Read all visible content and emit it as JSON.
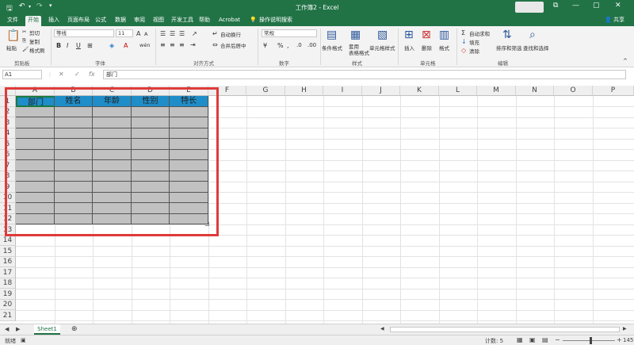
{
  "titlebar": {
    "title": "工作簿2  -  Excel",
    "minimize": "—",
    "restore": "▢",
    "close": "✕",
    "restore_ribbon": "⧉"
  },
  "tabs": [
    "文件",
    "开始",
    "插入",
    "页面布局",
    "公式",
    "数据",
    "审阅",
    "视图",
    "开发工具",
    "帮助",
    "Acrobat"
  ],
  "search_label": "操作说明搜索",
  "share_label": "共享",
  "clipboard": {
    "paste": "粘贴",
    "cut": "剪切",
    "copy": "复制",
    "format_painter": "格式刷",
    "group": "剪贴板"
  },
  "font": {
    "name": "等线",
    "size": "11",
    "bold": "B",
    "italic": "I",
    "underline": "U",
    "group": "字体",
    "size_up": "A",
    "size_down": "A",
    "wen": "wén"
  },
  "alignment": {
    "wrap": "自动换行",
    "merge": "合并后居中",
    "group": "对齐方式"
  },
  "number": {
    "format": "常规",
    "percent": "%",
    "comma": ",",
    "group": "数字"
  },
  "styles": {
    "conditional": "条件格式",
    "table": "套用\n表格格式",
    "cell_styles": "单元格样式",
    "group": "样式"
  },
  "cells": {
    "insert": "插入",
    "delete": "删除",
    "format": "格式",
    "group": "单元格"
  },
  "editing": {
    "autosum": "自动求和",
    "fill": "填充",
    "clear": "清除",
    "sort": "排序和筛选",
    "find": "查找和选择",
    "group": "编辑"
  },
  "formula_bar": {
    "name_box": "A1",
    "value": "部门"
  },
  "columns": [
    "A",
    "B",
    "C",
    "D",
    "E",
    "F",
    "G",
    "H",
    "I",
    "J",
    "K",
    "L",
    "M",
    "N",
    "O",
    "P"
  ],
  "rows": [
    "1",
    "2",
    "3",
    "4",
    "5",
    "6",
    "7",
    "8",
    "9",
    "10",
    "11",
    "12",
    "13",
    "14",
    "15",
    "16",
    "17",
    "18",
    "19",
    "20",
    "21"
  ],
  "table_headers": [
    "部门",
    "姓名",
    "年龄",
    "性别",
    "特长"
  ],
  "sheet_tab": "Sheet1",
  "status": {
    "ready": "就绪",
    "count": "计数: 5",
    "zoom": "145%"
  },
  "colors": {
    "accent": "#217346",
    "header_fill": "#1f8dc8",
    "body_fill": "#c1c1c1",
    "highlight": "#e03a3a"
  }
}
